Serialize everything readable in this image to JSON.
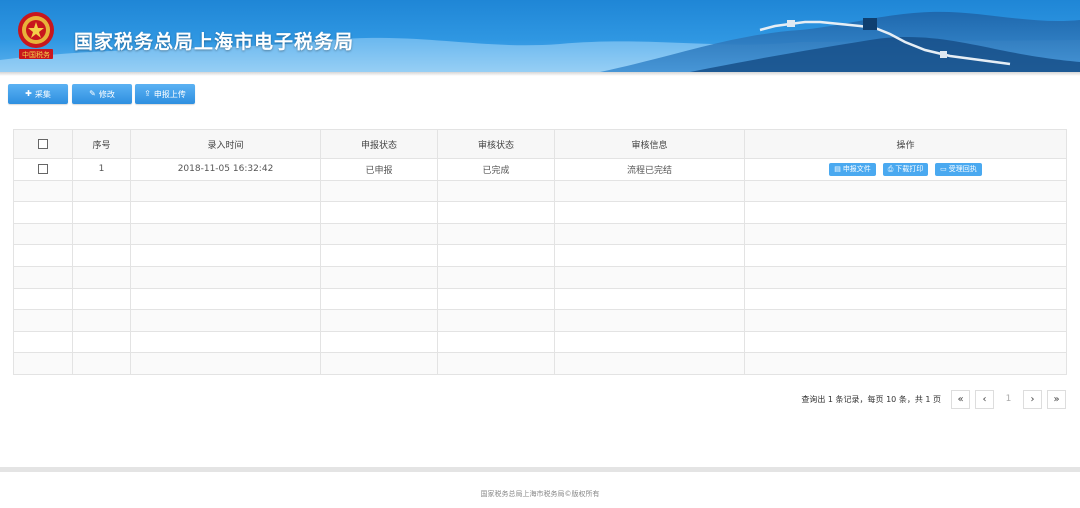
{
  "header": {
    "title": "国家税务总局上海市电子税务局",
    "emblem_text": "中国税务"
  },
  "toolbar": {
    "add_label": "采集",
    "edit_label": "修改",
    "upload_label": "申报上传"
  },
  "table": {
    "columns": [
      "",
      "序号",
      "录入时间",
      "申报状态",
      "审核状态",
      "审核信息",
      "操作"
    ],
    "rows": [
      {
        "index": "1",
        "time": "2018-11-05 16:32:42",
        "declare_status": "已申报",
        "review_status": "已完成",
        "review_info": "流程已完结",
        "actions": [
          "申报文件",
          "下载打印",
          "受理回执"
        ]
      }
    ]
  },
  "pagination": {
    "info": "查询出 1 条记录，每页 10 条，共 1 页",
    "current_page": "1",
    "first": "«",
    "prev": "‹",
    "next": "›",
    "last": "»"
  },
  "footer": {
    "copyright": "国家税务总局上海市税务局©版权所有"
  },
  "colors": {
    "header_blue": "#2f97e2",
    "button_blue": "#3a9ae6",
    "action_blue": "#4aa9f0"
  }
}
